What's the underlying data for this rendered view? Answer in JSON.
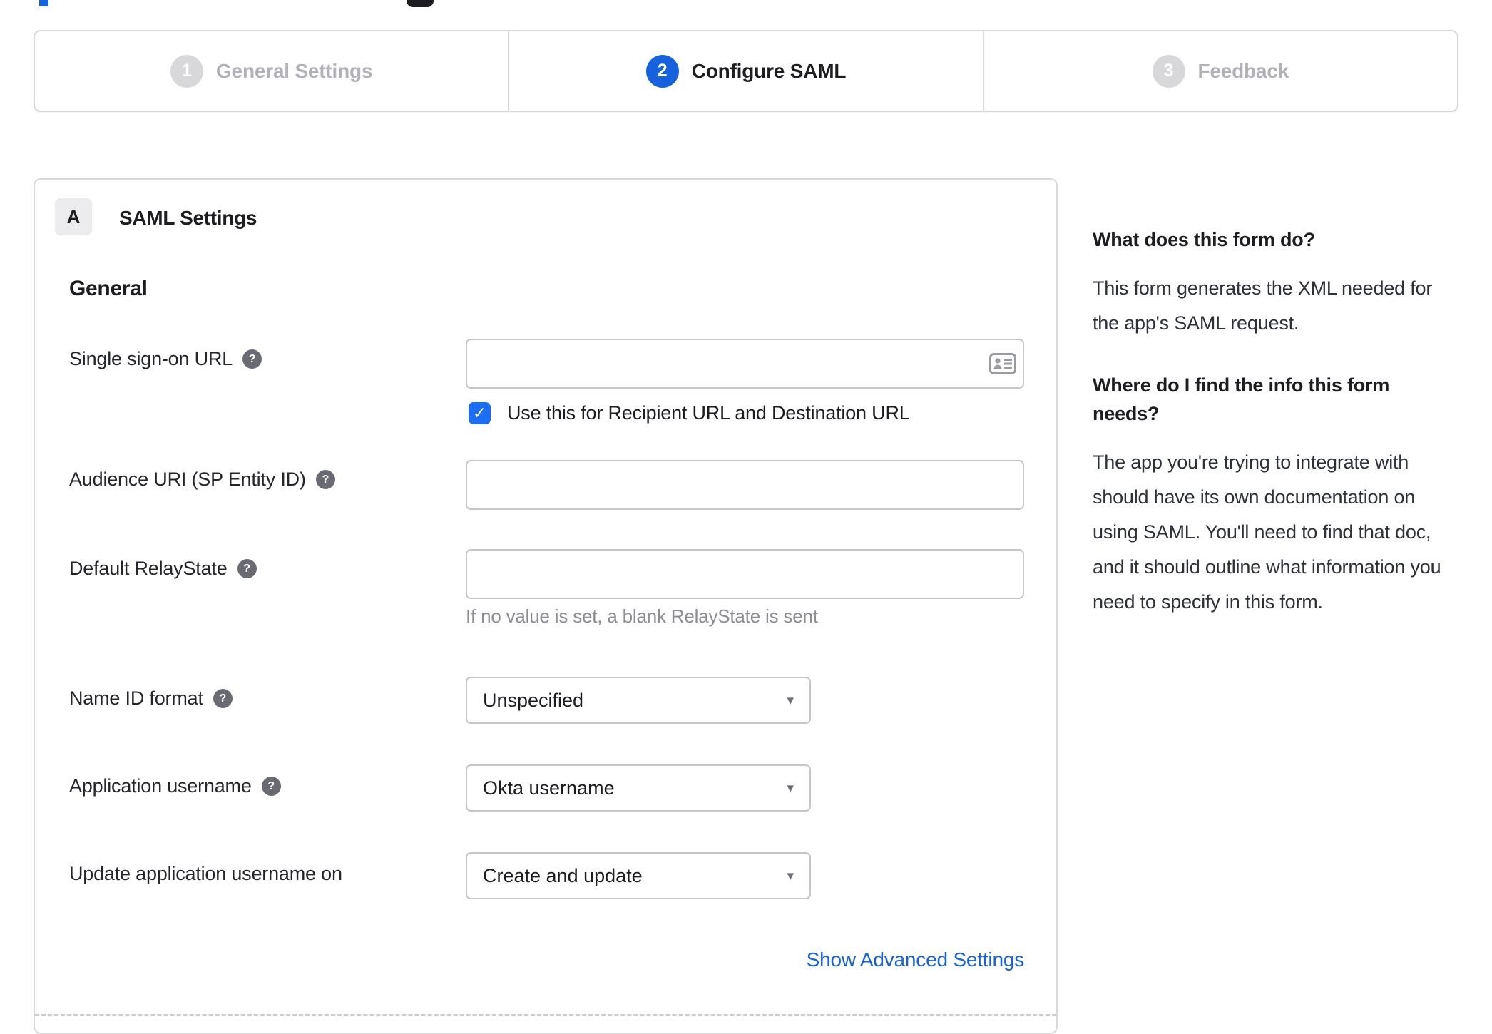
{
  "glyphs": {
    "help": "?",
    "caret": "▾",
    "check": "✓"
  },
  "stepper": {
    "steps": [
      {
        "number": "1",
        "label": "General Settings",
        "state": "inactive"
      },
      {
        "number": "2",
        "label": "Configure SAML",
        "state": "active"
      },
      {
        "number": "3",
        "label": "Feedback",
        "state": "inactive"
      }
    ]
  },
  "saml_panel": {
    "badge": "A",
    "title": "SAML Settings",
    "section_heading": "General",
    "single_sign_on": {
      "label": "Single sign-on URL",
      "value": "",
      "checkbox_label": "Use this for Recipient URL and Destination URL",
      "checkbox_checked": true
    },
    "audience_uri": {
      "label": "Audience URI (SP Entity ID)",
      "value": ""
    },
    "default_relay_state": {
      "label": "Default RelayState",
      "value": "",
      "hint": "If no value is set, a blank RelayState is sent"
    },
    "name_id_format": {
      "label": "Name ID format",
      "value": "Unspecified"
    },
    "application_username": {
      "label": "Application username",
      "value": "Okta username"
    },
    "update_application_username_on": {
      "label": "Update application username on",
      "value": "Create and update"
    },
    "advanced_settings_link": "Show Advanced Settings"
  },
  "help_panel": {
    "what_heading": "What does this form do?",
    "what_body": "This form generates the XML needed for the app's SAML request.",
    "where_heading": "Where do I find the info this form needs?",
    "where_body": "The app you're trying to integrate with should have its own documentation on using SAML. You'll need to find that doc, and it should outline what information you need to specify in this form."
  },
  "colors": {
    "accent_blue": "#1662dd",
    "checkbox_blue": "#1b6ef3",
    "link_blue": "#1661de",
    "inactive_gray": "#d8d8db"
  }
}
